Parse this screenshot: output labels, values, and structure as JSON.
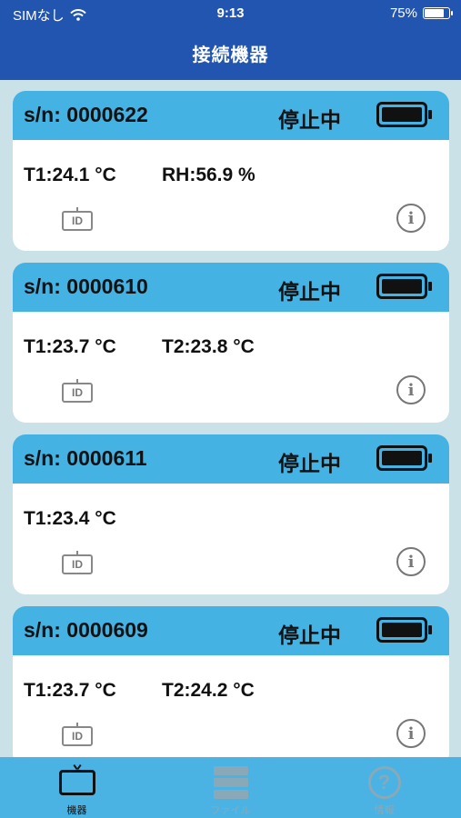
{
  "status_bar": {
    "carrier": "SIMなし",
    "time": "9:13",
    "battery_percent": "75%"
  },
  "header": {
    "title": "接続機器"
  },
  "devices": [
    {
      "serial": "s/n: 0000622",
      "state": "停止中",
      "reading1": "T1:24.1 °C",
      "reading2": "RH:56.9 %",
      "battery_level": 1.0
    },
    {
      "serial": "s/n: 0000610",
      "state": "停止中",
      "reading1": "T1:23.7 °C",
      "reading2": "T2:23.8 °C",
      "battery_level": 1.0
    },
    {
      "serial": "s/n: 0000611",
      "state": "停止中",
      "reading1": "T1:23.4 °C",
      "reading2": "",
      "battery_level": 1.0
    },
    {
      "serial": "s/n: 0000609",
      "state": "停止中",
      "reading1": "T1:23.7 °C",
      "reading2": "T2:24.2 °C",
      "battery_level": 1.0
    }
  ],
  "id_icon_text": "ID",
  "info_icon_text": "i",
  "tabs": [
    {
      "label": "機器",
      "icon": "device-icon",
      "active": true
    },
    {
      "label": "ファイル",
      "icon": "file-icon",
      "active": false
    },
    {
      "label": "情報",
      "icon": "help-icon",
      "active": false
    }
  ],
  "colors": {
    "header_bg": "#2255b0",
    "card_head_bg": "#44b2e3",
    "tab_bar_bg": "#4ab3e3",
    "page_bg": "#c9e1e7"
  }
}
